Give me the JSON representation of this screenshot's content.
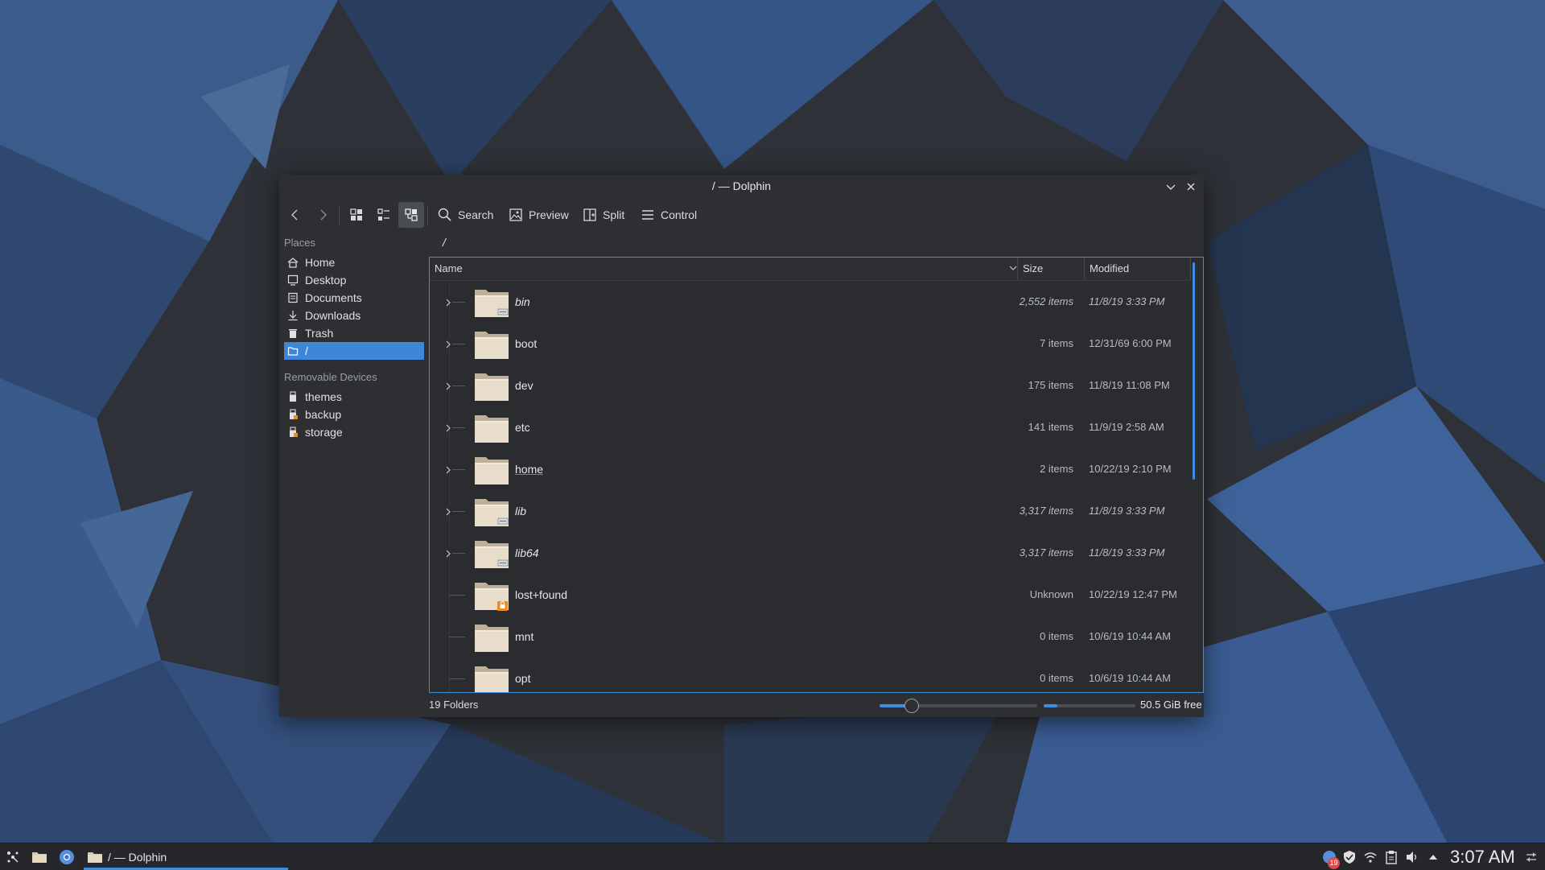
{
  "colors": {
    "accent": "#3d8ee0",
    "window_bg": "#2d2f33",
    "taskbar_bg": "#25272a"
  },
  "window": {
    "title": "/ — Dolphin"
  },
  "toolbar": {
    "back_icon": "chevron-left-icon",
    "forward_icon": "chevron-right-icon",
    "view_icons_icon": "icons-view-icon",
    "view_compact_icon": "compact-view-icon",
    "view_details_icon": "details-view-icon",
    "search_label": "Search",
    "preview_label": "Preview",
    "split_label": "Split",
    "control_label": "Control"
  },
  "places": {
    "heading": "Places",
    "items": [
      {
        "label": "Home",
        "icon": "home-icon"
      },
      {
        "label": "Desktop",
        "icon": "desktop-icon"
      },
      {
        "label": "Documents",
        "icon": "documents-icon"
      },
      {
        "label": "Downloads",
        "icon": "downloads-icon"
      },
      {
        "label": "Trash",
        "icon": "trash-icon"
      },
      {
        "label": "/",
        "icon": "folder-icon",
        "selected": true
      }
    ],
    "removable_heading": "Removable Devices",
    "devices": [
      {
        "label": "themes",
        "icon": "usb-drive-icon"
      },
      {
        "label": "backup",
        "icon": "usb-drive-icon"
      },
      {
        "label": "storage",
        "icon": "usb-drive-icon"
      }
    ]
  },
  "location": {
    "path": "/"
  },
  "columns": {
    "name": "Name",
    "size": "Size",
    "modified": "Modified"
  },
  "rows": [
    {
      "name": "bin",
      "size": "2,552 items",
      "modified": "11/8/19 3:33 PM",
      "italic": true,
      "expandable": true,
      "emblem": "link"
    },
    {
      "name": "boot",
      "size": "7 items",
      "modified": "12/31/69 6:00 PM",
      "italic": false,
      "expandable": true
    },
    {
      "name": "dev",
      "size": "175 items",
      "modified": "11/8/19 11:08 PM",
      "italic": false,
      "expandable": true
    },
    {
      "name": "etc",
      "size": "141 items",
      "modified": "11/9/19 2:58 AM",
      "italic": false,
      "expandable": true
    },
    {
      "name": "home",
      "size": "2 items",
      "modified": "10/22/19 2:10 PM",
      "italic": false,
      "expandable": true,
      "hovered": true
    },
    {
      "name": "lib",
      "size": "3,317 items",
      "modified": "11/8/19 3:33 PM",
      "italic": true,
      "expandable": true,
      "emblem": "link"
    },
    {
      "name": "lib64",
      "size": "3,317 items",
      "modified": "11/8/19 3:33 PM",
      "italic": true,
      "expandable": true,
      "emblem": "link"
    },
    {
      "name": "lost+found",
      "size": "Unknown",
      "modified": "10/22/19 12:47 PM",
      "italic": false,
      "expandable": false,
      "emblem": "lock"
    },
    {
      "name": "mnt",
      "size": "0 items",
      "modified": "10/6/19 10:44 AM",
      "italic": false,
      "expandable": false
    },
    {
      "name": "opt",
      "size": "0 items",
      "modified": "10/6/19 10:44 AM",
      "italic": false,
      "expandable": false
    }
  ],
  "status": {
    "summary": "19 Folders",
    "zoom_level": 0.2,
    "space_used_fraction": 0.15,
    "free_space": "50.5 GiB free"
  },
  "taskbar": {
    "task_label": "/ — Dolphin",
    "badge_count": "19",
    "clock": "3:07 AM"
  }
}
